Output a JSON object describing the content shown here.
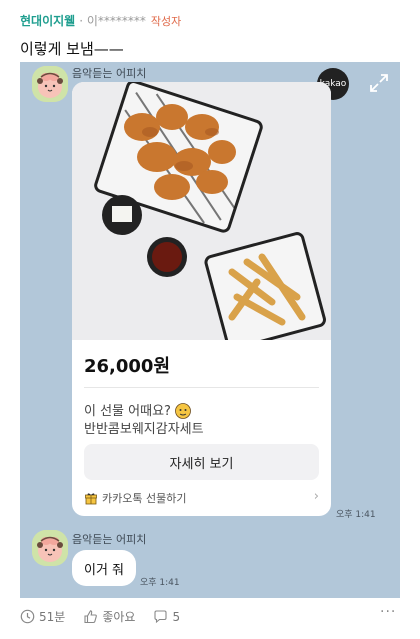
{
  "comment": {
    "author": "현대이지웰",
    "meta_id": "· 이********",
    "writer_tag": "작성자",
    "text": "이렇게 보냄——"
  },
  "chat": {
    "sender_name": "음악듣는 어피치",
    "kakao_badge": "kakao",
    "gift_card": {
      "price": "26,000원",
      "question": "이 선물 어때요?",
      "product_name": "반반콤보웨지감자세트",
      "detail_button": "자세히 보기",
      "footer_label": "카카오톡 선물하기"
    },
    "card_time": "오후 1:41",
    "message_text": "이거 줘",
    "message_time": "오후 1:41"
  },
  "actions": {
    "time_ago": "51분",
    "like_label": "좋아요",
    "reply_count": "5",
    "more": "···"
  }
}
